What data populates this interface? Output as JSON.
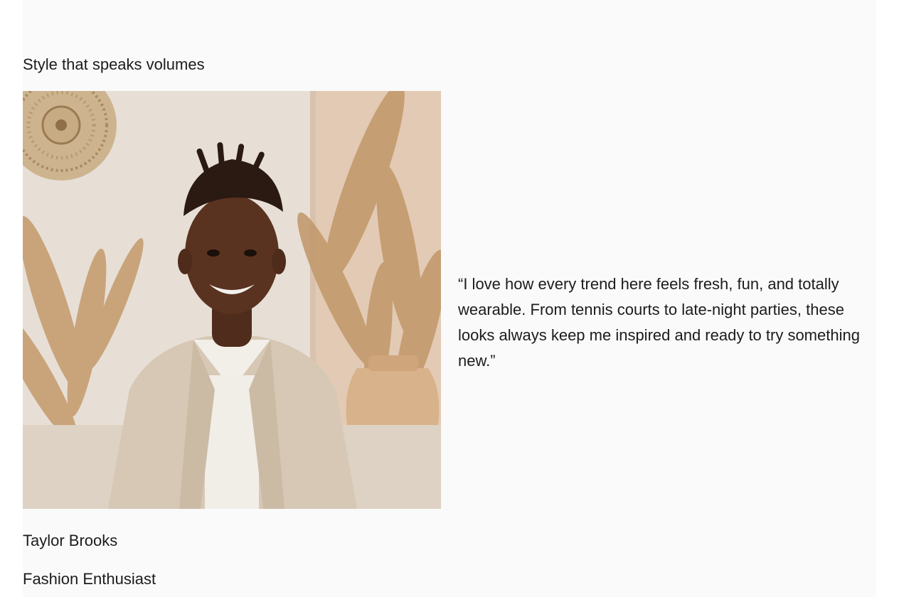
{
  "testimonial": {
    "heading": "Style that speaks volumes",
    "quote": "“I love how every trend here feels fresh, fun, and totally wearable. From tennis courts to late-night parties, these looks always keep me inspired and ready to try something new.”",
    "author_name": "Taylor Brooks",
    "author_role": "Fashion Enthusiast"
  },
  "colors": {
    "background": "#fafafa",
    "text": "#1c1c1c",
    "photo_wall": "#e9e0d6",
    "photo_wall_right": "#e4cdb8",
    "jacket": "#d8cbb8",
    "skin": "#5a3320"
  }
}
